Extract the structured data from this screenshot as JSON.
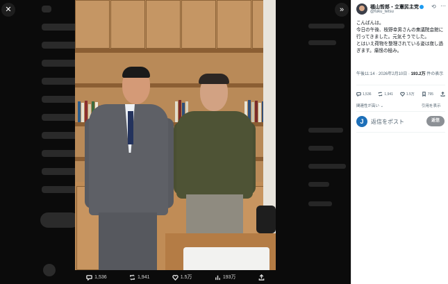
{
  "viewer": {
    "close_symbol": "✕",
    "expand_symbol": "»",
    "actions": [
      {
        "icon": "reply-icon",
        "count": "1,536"
      },
      {
        "icon": "repost-icon",
        "count": "1,941"
      },
      {
        "icon": "like-icon",
        "count": "1.5万"
      },
      {
        "icon": "views-icon",
        "count": "193万"
      },
      {
        "icon": "share-icon",
        "count": ""
      }
    ]
  },
  "post": {
    "author_name": "福山哲郎・立憲民主党",
    "handle": "@fuku_tetsu",
    "text": "こんばんは。\n今日の午後、枝野幸男さんの衆議院会館に行ってきました。元気そうでした。\nとはいえ荷物を整理されている姿は寂し過ぎます。痛恨の極み。",
    "time": "午後11:14 · 2026年2月10日 · ",
    "views_count": "193.2万",
    "views_suffix": " 件の表示",
    "stats": {
      "replies": "1,536",
      "reposts": "1,941",
      "likes": "1.5万",
      "bookmarks": "795"
    },
    "related_label": "関連性が高い",
    "quotes_label": "引用を表示"
  },
  "reply_box": {
    "avatar_letter": "J",
    "placeholder": "返信をポスト",
    "button_label": "返信"
  },
  "colors": {
    "accent": "#1d9bf0",
    "overlay": "#101010",
    "reply_button": "#8c9095"
  }
}
